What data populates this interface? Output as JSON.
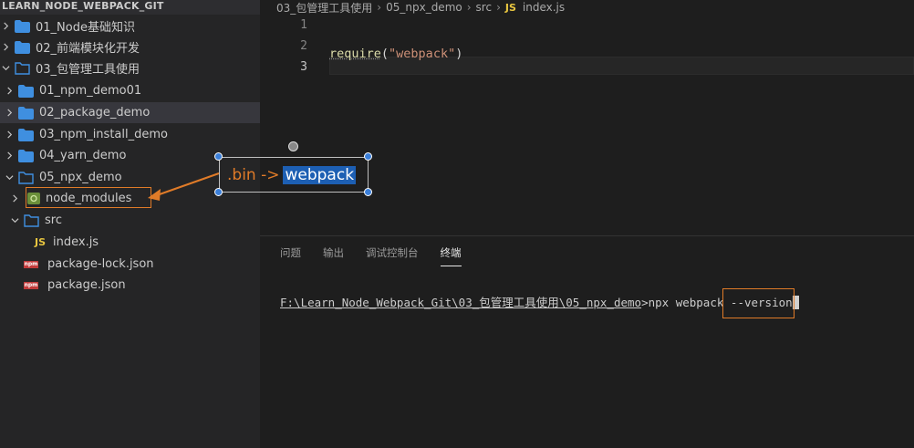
{
  "sidebar": {
    "root_title": "LEARN_NODE_WEBPACK_GIT",
    "items": [
      {
        "label": "01_Node基础知识",
        "type": "folder"
      },
      {
        "label": "02_前端模块化开发",
        "type": "folder"
      },
      {
        "label": "03_包管理工具使用",
        "type": "folder-open"
      },
      {
        "label": "01_npm_demo01",
        "type": "folder"
      },
      {
        "label": "02_package_demo",
        "type": "folder"
      },
      {
        "label": "03_npm_install_demo",
        "type": "folder"
      },
      {
        "label": "04_yarn_demo",
        "type": "folder"
      },
      {
        "label": "05_npx_demo",
        "type": "folder-open"
      },
      {
        "label": "node_modules",
        "type": "folder"
      },
      {
        "label": "src",
        "type": "folder-open"
      },
      {
        "label": "index.js",
        "type": "js"
      },
      {
        "label": "package-lock.json",
        "type": "npm"
      },
      {
        "label": "package.json",
        "type": "npm"
      }
    ]
  },
  "editor": {
    "breadcrumb": [
      "03_包管理工具使用",
      "05_npx_demo",
      "src"
    ],
    "file_badge": "JS",
    "file_name": "index.js",
    "line_numbers": [
      "1",
      "2",
      "3"
    ],
    "code_fn": "require",
    "code_open": "(",
    "code_str": "\"webpack\"",
    "code_close": ")"
  },
  "annotation": {
    "prefix": ".bin ->",
    "selected": "webpack"
  },
  "panel": {
    "tabs": [
      "问题",
      "输出",
      "调试控制台",
      "终端"
    ],
    "active_tab": "终端",
    "terminal_path": "F:\\Learn_Node_Webpack_Git\\03_包管理工具使用\\05_npx_demo",
    "terminal_cmd_prefix": ">npx ",
    "terminal_cmd_highlight": "webpack",
    "terminal_cmd_suffix": " --version"
  },
  "colors": {
    "accent_orange": "#e07b28",
    "folder_blue": "#3f8fe0",
    "selection_blue": "#1d5fb3"
  }
}
